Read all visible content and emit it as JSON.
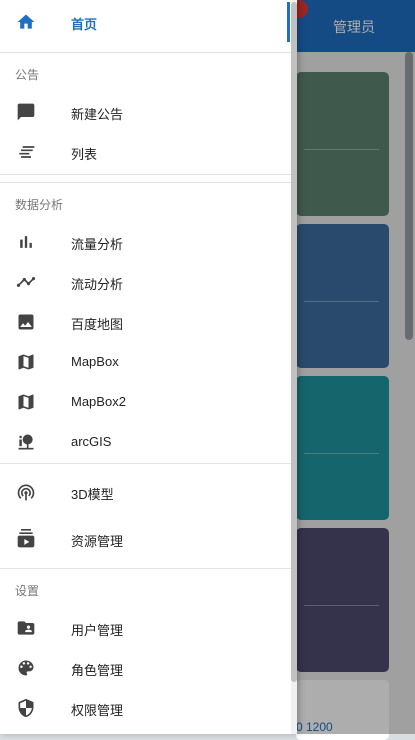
{
  "background": {
    "topbar_title": "管理员",
    "partial_values": "0  1200"
  },
  "nav": {
    "home": "首页",
    "section_announcement": "公告",
    "new_announcement": "新建公告",
    "list": "列表",
    "section_analysis": "数据分析",
    "traffic_analysis": "流量分析",
    "flow_analysis": "流动分析",
    "baidu_map": "百度地图",
    "mapbox": "MapBox",
    "mapbox2": "MapBox2",
    "arcgis": "arcGIS",
    "model_3d": "3D模型",
    "resource_management": "资源管理",
    "section_settings": "设置",
    "user_management": "用户管理",
    "role_management": "角色管理",
    "permission_management": "权限管理"
  },
  "colors": {
    "accent": "#1f6fc4",
    "icon": "#444444",
    "card1": "#5f8472",
    "card2": "#3d6ea1",
    "card3": "#1f95a0",
    "card4": "#4e4b71"
  },
  "icons": {
    "home": "home-icon",
    "new_announcement": "chat-bubble-icon",
    "list": "list-lines-icon",
    "traffic_analysis": "bar-chart-icon",
    "flow_analysis": "trend-line-icon",
    "baidu_map": "image-icon",
    "mapbox": "map-icon",
    "mapbox2": "map-icon",
    "arcgis": "tree-location-icon",
    "model_3d": "signal-icon",
    "resource_management": "media-stack-icon",
    "user_management": "account-folder-icon",
    "role_management": "palette-icon",
    "permission_management": "shield-icon"
  }
}
